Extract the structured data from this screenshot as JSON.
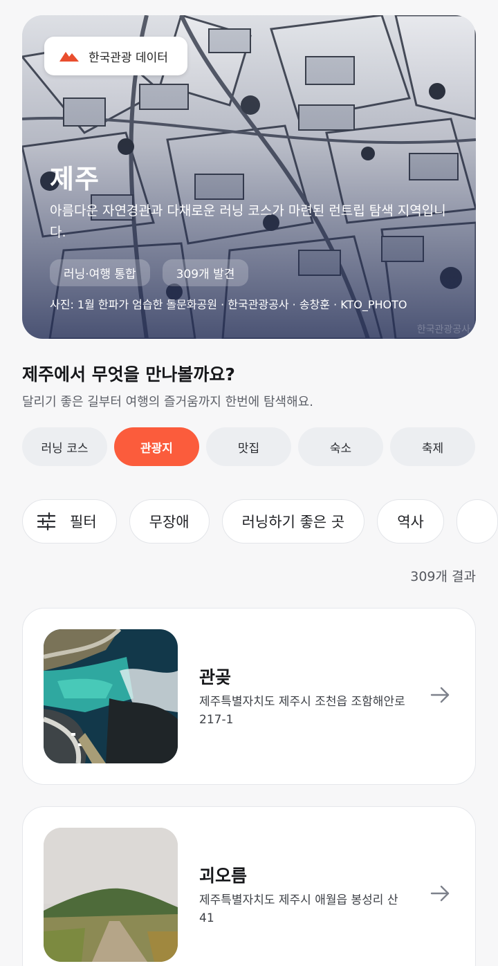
{
  "hero": {
    "source_badge": "한국관광 데이터",
    "title": "제주",
    "description": "아름다운 자연경관과 다채로운 러닝 코스가 마련된 런트립 탐색 지역입니다.",
    "chips": [
      "러닝·여행 통합",
      "309개 발견"
    ],
    "credit": "사진: 1월 한파가 엄습한 돌문화공원 · 한국관광공사 · 송창훈 · KTO_PHOTO",
    "watermark": "한국관광공사",
    "accent_color": "#e94e2e"
  },
  "section": {
    "title": "제주에서 무엇을 만나볼까요?",
    "subtitle": "달리기 좋은 길부터 여행의 즐거움까지 한번에 탐색해요."
  },
  "categories": [
    {
      "label": "러닝 코스",
      "active": false
    },
    {
      "label": "관광지",
      "active": true
    },
    {
      "label": "맛집",
      "active": false
    },
    {
      "label": "숙소",
      "active": false
    },
    {
      "label": "축제",
      "active": false
    }
  ],
  "filters": {
    "filter_label": "필터",
    "chips": [
      "무장애",
      "러닝하기 좋은 곳",
      "역사"
    ]
  },
  "result_count": "309개 결과",
  "places": [
    {
      "name": "관곶",
      "address": "제주특별자치도 제주시 조천읍 조함해안로 217-1",
      "icon": "arrow-right-icon"
    },
    {
      "name": "괴오름",
      "address": "제주특별자치도 제주시 애월읍 봉성리 산41",
      "icon": "arrow-right-icon"
    }
  ],
  "colors": {
    "active_category": "#fb5c3c",
    "background": "#f7f7f8"
  }
}
